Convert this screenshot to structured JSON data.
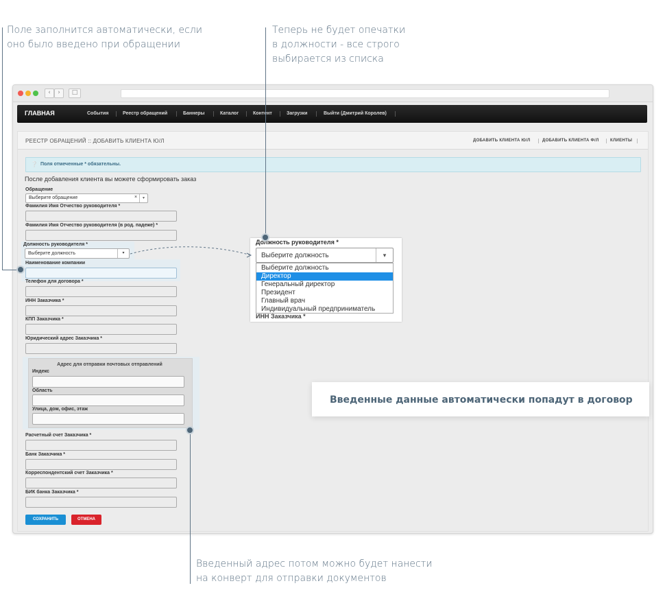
{
  "callouts": {
    "autofill": "Поле заполнится автоматически, если\nоно было введено при обращении",
    "no_typos": "Теперь не будет опечатки\nв должности - все строго\nвыбирается из списка",
    "contract": "Введенные данные автоматически попадут в договор",
    "envelope": "Введенный адрес потом можно будет нанести\nна конверт для отправки документов"
  },
  "nav": {
    "brand": "ГЛАВНАЯ",
    "items": [
      "События",
      "Реестр обращений",
      "Баннеры",
      "Каталог",
      "Контент",
      "Загрузки",
      "Выйти (Дмитрий Королев)"
    ]
  },
  "panel": {
    "title": "РЕЕСТР ОБРАЩЕНИЙ :: ДОБАВИТЬ КЛИЕНТА Ю/Л",
    "links": [
      "ДОБАВИТЬ КЛИЕНТА Ю/Л",
      "ДОБАВИТЬ КЛИЕНТА Ф/Л",
      "КЛИЕНТЫ"
    ]
  },
  "alert": "Поля отмеченные * обязательны.",
  "intro": "После добавления клиента вы можете сформировать заказ",
  "form": {
    "request_label": "Обращение",
    "request_value": "Выберите обращение",
    "director_name_label": "Фамилия Имя Отчество руководителя *",
    "director_name_gen_label": "Фамилия Имя Отчество руководителя (в род. падеже) *",
    "position_label": "Должность руководителя *",
    "position_value": "Выберите должность",
    "company_label": "Наименование компании",
    "phone_label": "Телефон для договора *",
    "inn_label": "ИНН Заказчика *",
    "kpp_label": "КПП Заказчика *",
    "legal_address_label": "Юридический адрес Заказчика *",
    "postal_title": "Адрес для отправки почтовых отправлений",
    "index_label": "Индекс",
    "region_label": "Область",
    "street_label": "Улица, дом, офис, этаж",
    "account_label": "Расчетный счет Заказчика *",
    "bank_label": "Банк Заказчика *",
    "corr_account_label": "Корреспондентский счет Заказчика *",
    "bik_label": "БИК банка Заказчика *",
    "save_label": "СОХРАНИТЬ",
    "cancel_label": "ОТМЕНА"
  },
  "popup": {
    "label": "Должность руководителя *",
    "value": "Выберите должность",
    "options": [
      "Выберите должность",
      "Директор",
      "Генеральный директор",
      "Президент",
      "Главный врач",
      "Индивидуальный предприниматель"
    ],
    "selected_index": 1,
    "below_label": "ИНН Заказчика *"
  },
  "colors": {
    "accent": "#1e8fe6",
    "callout": "#5f7486",
    "save": "#1a8fd4",
    "cancel": "#d9232b"
  }
}
